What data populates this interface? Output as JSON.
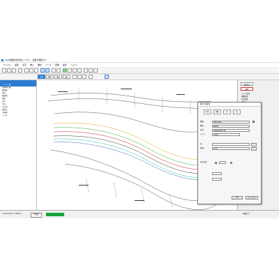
{
  "window": {
    "title": "CAD図面作成支援システム - 道路平面図.sfc"
  },
  "menu": [
    "ファイル",
    "編集",
    "表示",
    "挿入",
    "書式",
    "ツール",
    "測量",
    "設計",
    "ヘルプ"
  ],
  "toolbar2": {
    "tab1": "平面",
    "tab2": "縦断",
    "tab3": "横断",
    "tab4": "設定"
  },
  "left_panel": {
    "rows": [
      "レイヤ一覧",
      "道路中心線",
      "幅員線",
      "測点",
      "構造物",
      "地形",
      "文字",
      "寸法",
      "その他",
      "基準点",
      "引出線",
      "ハッチ"
    ]
  },
  "right_panel": {
    "button1": "画面表示",
    "button2": "削除",
    "items": [
      "レイヤ設定",
      "線種設定",
      "文字設定",
      "印刷",
      "出力"
    ]
  },
  "dialog": {
    "title": "線分の属性",
    "tab_labels": [
      "基本",
      "線種",
      "文字",
      "寸法"
    ],
    "fields": [
      {
        "label": "図面",
        "value": "道路平面図"
      },
      {
        "label": "種別",
        "value": "構造線"
      },
      {
        "label": "名称",
        "value": "道路幅員線(左側)"
      },
      {
        "label": "レイヤ",
        "value": "4 幅員"
      },
      {
        "label": "色",
        "value": ""
      },
      {
        "label": "線幅",
        "value": "0.25"
      }
    ],
    "option_label": "表示設定",
    "ok_label": "OK",
    "cancel_label": "キャンセル"
  },
  "statusbar": {
    "left": "X=1234.56 Y=789.01",
    "tab": "平面図",
    "right": "準備完了"
  },
  "colors": {
    "accent": "#2a7bd1",
    "status_green": "#17a33a"
  }
}
